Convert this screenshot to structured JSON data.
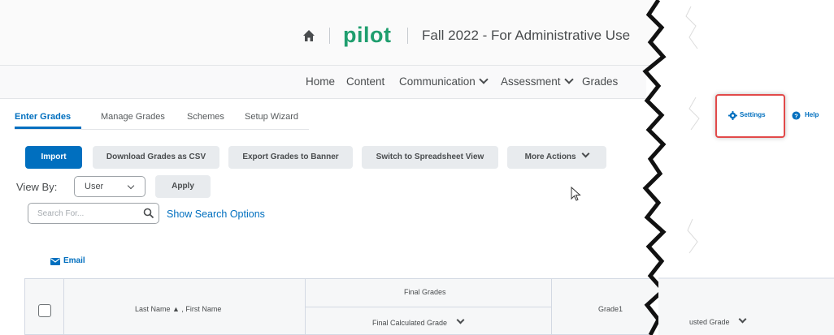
{
  "header": {
    "brand": "pilot",
    "course_title": "Fall 2022 - For Administrative Use"
  },
  "nav": {
    "items": [
      {
        "label": "Home"
      },
      {
        "label": "Content"
      },
      {
        "label": "Communication"
      },
      {
        "label": "Assessment"
      },
      {
        "label": "Grades"
      }
    ]
  },
  "tabs": [
    {
      "label": "Enter Grades",
      "active": true
    },
    {
      "label": "Manage Grades"
    },
    {
      "label": "Schemes"
    },
    {
      "label": "Setup Wizard"
    }
  ],
  "toolbar": {
    "import": "Import",
    "download_csv": "Download Grades as CSV",
    "export_banner": "Export Grades to Banner",
    "spreadsheet_view": "Switch to Spreadsheet View",
    "more_actions": "More Actions"
  },
  "filters": {
    "view_by_label": "View By:",
    "view_by_value": "User",
    "apply": "Apply",
    "search_placeholder": "Search For...",
    "show_search_options": "Show Search Options"
  },
  "email": {
    "label": "Email"
  },
  "table": {
    "name_header": "Last Name ▲ , First Name",
    "final_grades_group": "Final Grades",
    "final_calculated": "Final Calculated Grade",
    "grade1": "Grade1",
    "adjusted_grade": "usted Grade"
  },
  "right_panel": {
    "settings": "Settings",
    "help": "Help"
  },
  "colors": {
    "brand_green": "#1f9e6e",
    "link_blue": "#006fbf",
    "highlight_red": "#e24a4a"
  }
}
